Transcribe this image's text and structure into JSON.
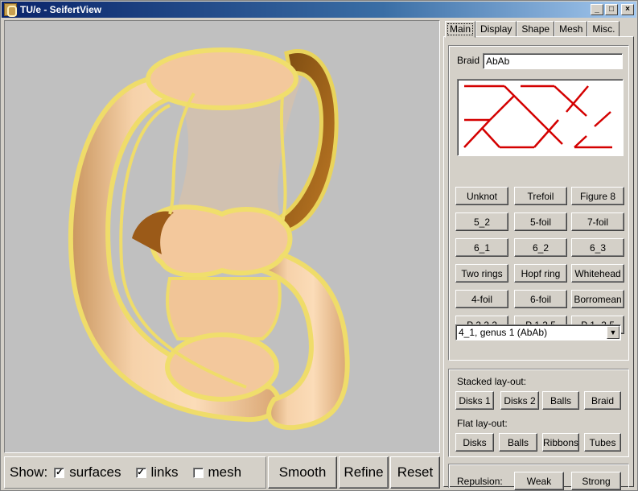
{
  "window": {
    "title": "TU/e - SeifertView",
    "minimize": "_",
    "maximize": "□",
    "close": "×"
  },
  "tabs": [
    "Main",
    "Display",
    "Shape",
    "Mesh",
    "Misc."
  ],
  "braid": {
    "label": "Braid",
    "value": "AbAb"
  },
  "knot_buttons": [
    [
      "Unknot",
      "Trefoil",
      "Figure 8"
    ],
    [
      "5_2",
      "5-foil",
      "7-foil"
    ],
    [
      "6_1",
      "6_2",
      "6_3"
    ],
    [
      "Two rings",
      "Hopf ring",
      "Whitehead"
    ],
    [
      "4-foil",
      "6-foil",
      "Borromean"
    ],
    [
      "P 2,2,2",
      "P 1,3,5",
      "P 1,-3,5"
    ]
  ],
  "knot_select": {
    "value": "4_1, genus 1 (AbAb)",
    "arrow": "▼"
  },
  "stacked": {
    "label": "Stacked lay-out:",
    "buttons": [
      "Disks 1",
      "Disks 2",
      "Balls",
      "Braid"
    ]
  },
  "flat": {
    "label": "Flat lay-out:",
    "buttons": [
      "Disks",
      "Balls",
      "Ribbons",
      "Tubes"
    ]
  },
  "repulsion": {
    "label": "Repulsion:",
    "buttons": [
      "Weak",
      "Strong"
    ]
  },
  "show": {
    "label": "Show:",
    "items": [
      {
        "label": "surfaces",
        "checked": "✓"
      },
      {
        "label": "links",
        "checked": "✓"
      },
      {
        "label": "mesh",
        "checked": ""
      }
    ]
  },
  "actions": {
    "smooth": "Smooth",
    "refine": "Refine",
    "reset": "Reset"
  },
  "colors": {
    "background": "#c0c0c0",
    "surface": "#f3c89c",
    "link": "#f2e27a",
    "braid_line": "#d40000",
    "titlebar": "#0a246a"
  }
}
